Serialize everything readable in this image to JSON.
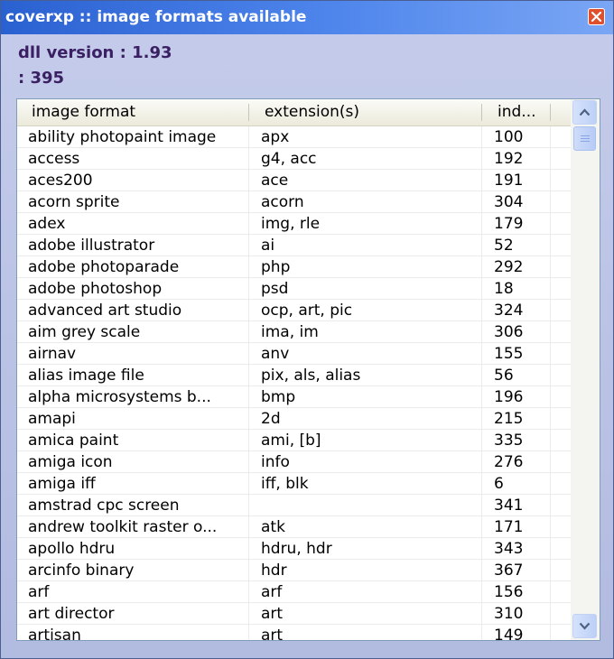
{
  "window": {
    "title": "coverxp :: image formats available",
    "close_icon": "close-icon"
  },
  "info": {
    "dll_version": "dll version : 1.93",
    "count": ": 395"
  },
  "list": {
    "columns": [
      "image format",
      "extension(s)",
      "ind..."
    ],
    "rows": [
      {
        "format": "ability photopaint image",
        "ext": "apx",
        "index": "100"
      },
      {
        "format": "access",
        "ext": "g4, acc",
        "index": "192"
      },
      {
        "format": "aces200",
        "ext": "ace",
        "index": "191"
      },
      {
        "format": "acorn sprite",
        "ext": "acorn",
        "index": "304"
      },
      {
        "format": "adex",
        "ext": "img, rle",
        "index": "179"
      },
      {
        "format": "adobe illustrator",
        "ext": "ai",
        "index": "52"
      },
      {
        "format": "adobe photoparade",
        "ext": "php",
        "index": "292"
      },
      {
        "format": "adobe photoshop",
        "ext": "psd",
        "index": "18"
      },
      {
        "format": "advanced art studio",
        "ext": "ocp, art, pic",
        "index": "324"
      },
      {
        "format": "aim grey scale",
        "ext": "ima, im",
        "index": "306"
      },
      {
        "format": "airnav",
        "ext": "anv",
        "index": "155"
      },
      {
        "format": "alias image file",
        "ext": "pix, als, alias",
        "index": "56"
      },
      {
        "format": "alpha microsystems b...",
        "ext": "bmp",
        "index": "196"
      },
      {
        "format": "amapi",
        "ext": "2d",
        "index": "215"
      },
      {
        "format": "amica paint",
        "ext": "ami, [b]",
        "index": "335"
      },
      {
        "format": "amiga icon",
        "ext": "info",
        "index": "276"
      },
      {
        "format": "amiga iff",
        "ext": "iff, blk",
        "index": "6"
      },
      {
        "format": "amstrad cpc screen",
        "ext": "",
        "index": "341"
      },
      {
        "format": "andrew toolkit raster o...",
        "ext": "atk",
        "index": "171"
      },
      {
        "format": "apollo hdru",
        "ext": "hdru, hdr",
        "index": "343"
      },
      {
        "format": "arcinfo binary",
        "ext": "hdr",
        "index": "367"
      },
      {
        "format": "arf",
        "ext": "arf",
        "index": "156"
      },
      {
        "format": "art director",
        "ext": "art",
        "index": "310"
      },
      {
        "format": "artisan",
        "ext": "art",
        "index": "149"
      }
    ]
  },
  "scrollbar": {
    "up_icon": "scroll-up-icon",
    "down_icon": "scroll-down-icon"
  }
}
